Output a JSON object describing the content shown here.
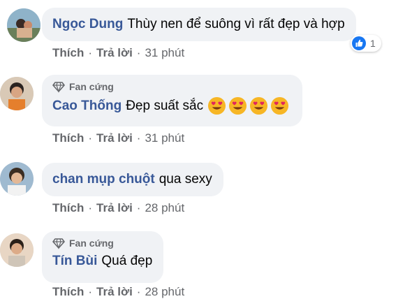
{
  "comments": [
    {
      "author": "Ngọc Dung",
      "text": "Thùy nen để suông vì rất đẹp và hợp",
      "like_label": "Thích",
      "reply_label": "Trả lời",
      "time": "31 phút",
      "reaction_count": "1",
      "reaction_icon": "like-icon"
    },
    {
      "badge": "Fan cứng",
      "author": "Cao Thống",
      "text": "Đẹp suất sắc",
      "emojis": [
        "heart-eyes-emoji",
        "heart-eyes-emoji",
        "heart-eyes-emoji",
        "heart-eyes-emoji"
      ],
      "like_label": "Thích",
      "reply_label": "Trả lời",
      "time": "31 phút"
    },
    {
      "author": "chan mụp chuột",
      "text": "qua sexy",
      "like_label": "Thích",
      "reply_label": "Trả lời",
      "time": "28 phút"
    },
    {
      "badge": "Fan cứng",
      "author": "Tín Bùi",
      "text": "Quá đẹp",
      "like_label": "Thích",
      "reply_label": "Trả lời",
      "time": "28 phút"
    }
  ],
  "colors": {
    "author": "#385898",
    "bubble": "#f0f2f5",
    "meta": "#65676b",
    "like_blue": "#1877f2"
  }
}
